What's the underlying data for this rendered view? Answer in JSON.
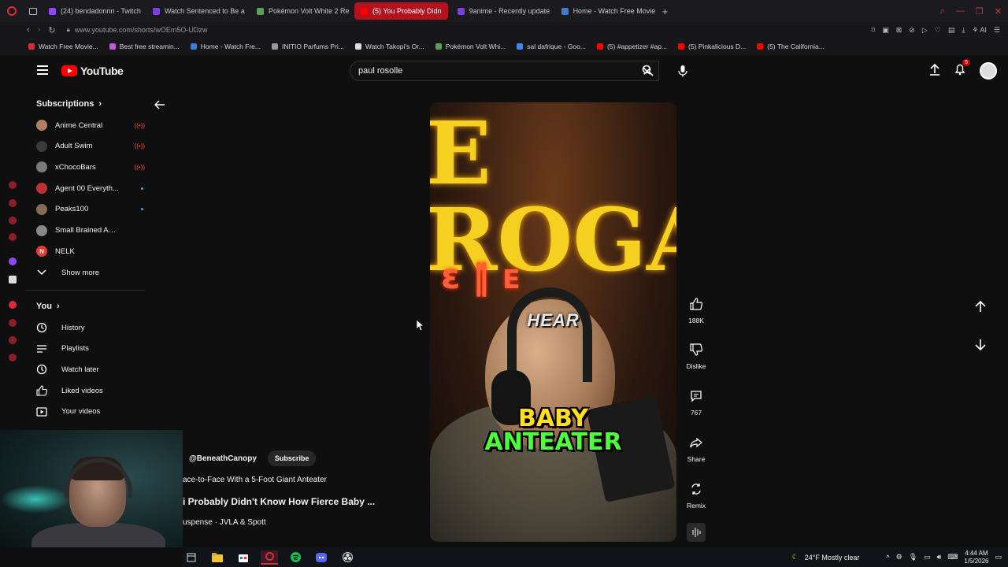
{
  "browser": {
    "tabs": [
      {
        "label": "(24) bendadonnn - Twitch",
        "color": "#9146ff",
        "active": false
      },
      {
        "label": "Watch Sentenced to Be a",
        "color": "#7b3fe4",
        "active": false
      },
      {
        "label": "Pokémon Volt White 2 Re",
        "color": "#5aa05a",
        "active": false
      },
      {
        "label": "(5) You Probably Didn",
        "color": "#ff0000",
        "active": true
      },
      {
        "label": "9anime - Recently update",
        "color": "#7b3fe4",
        "active": false
      },
      {
        "label": "Home - Watch Free Movie",
        "color": "#3d7bd8",
        "active": false
      }
    ],
    "url": "www.youtube.com/shorts/wOEm5O-UDzw",
    "bookmarks": [
      {
        "label": "Watch Free Movie...",
        "color": "#e0283c"
      },
      {
        "label": "Best free streamin...",
        "color": "#c35bd8"
      },
      {
        "label": "Home - Watch Fre...",
        "color": "#3d7bd8"
      },
      {
        "label": "INITIO Parfums Pri...",
        "color": "#999999"
      },
      {
        "label": "Watch Takopi's Or...",
        "color": "#dddddd"
      },
      {
        "label": "Pokémon Volt Whi...",
        "color": "#5aa05a"
      },
      {
        "label": "sal dafrique - Goo...",
        "color": "#4285f4"
      },
      {
        "label": "(5) #appetizer #ap...",
        "color": "#ff0000"
      },
      {
        "label": "(5) Pinkalicious D...",
        "color": "#ff0000"
      },
      {
        "label": "(5) The California...",
        "color": "#ff0000"
      }
    ]
  },
  "youtube": {
    "logo_text": "YouTube",
    "search_value": "paul rosolle",
    "notification_count": "5"
  },
  "sidebar": {
    "subscriptions_title": "Subscriptions",
    "subscriptions": [
      {
        "name": "Anime Central",
        "status": "live",
        "color": "#b08060"
      },
      {
        "name": "Adult Swim",
        "status": "live",
        "color": "#3a3a3a"
      },
      {
        "name": "xChocoBars",
        "status": "live",
        "color": "#7a7a7a"
      },
      {
        "name": "Agent 00 Everyth...",
        "status": "new",
        "color": "#c03030"
      },
      {
        "name": "Peaks100",
        "status": "new",
        "color": "#8a6a50"
      },
      {
        "name": "Small Brained Ame...",
        "status": "none",
        "color": "#888888"
      },
      {
        "name": "NELK",
        "status": "none",
        "color": "#e53935"
      }
    ],
    "nelk_letter": "N",
    "show_more": "Show more",
    "you_title": "You",
    "you_items": [
      {
        "label": "History",
        "icon": "history-icon"
      },
      {
        "label": "Playlists",
        "icon": "playlists-icon"
      },
      {
        "label": "Watch later",
        "icon": "watch-later-icon"
      },
      {
        "label": "Liked videos",
        "icon": "liked-videos-icon"
      },
      {
        "label": "Your videos",
        "icon": "your-videos-icon"
      }
    ]
  },
  "short": {
    "caption_word": "HEAR",
    "caption_line1": "BABY",
    "caption_line2": "ANTEATER",
    "neon_sign": "E ROGA",
    "channel_handle": "@BeneathCanopy",
    "subscribe_label": "Subscribe",
    "description": "ace-to-Face With a 5-Foot Giant Anteater",
    "title": "i Probably Didn't Know How Fierce Baby ...",
    "music": "uspense · JVLA & Spott",
    "likes": "188K",
    "dislike_label": "Dislike",
    "comments": "767",
    "share_label": "Share",
    "remix_label": "Remix"
  },
  "taskbar": {
    "weather": "24°F  Mostly clear",
    "time": "4:44 AM",
    "date": "1/5/2026"
  }
}
